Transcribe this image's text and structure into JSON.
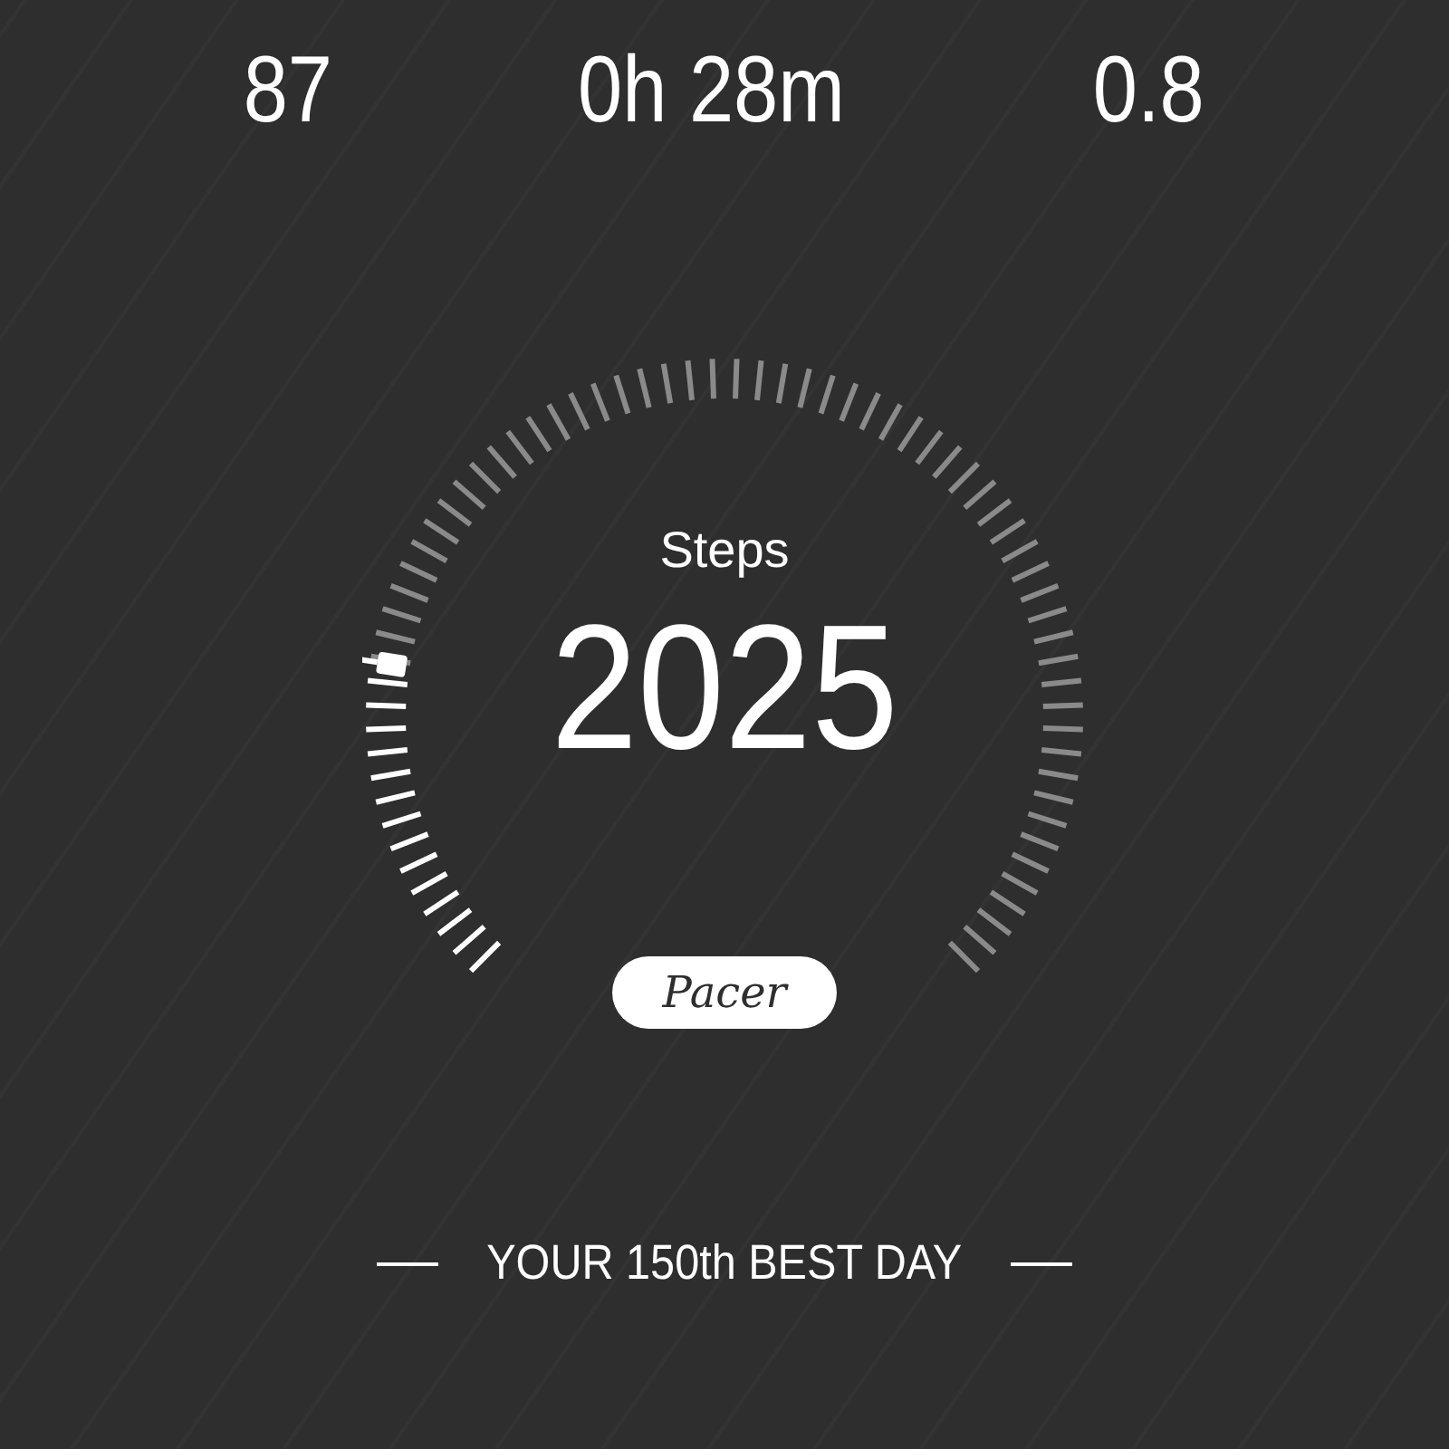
{
  "stats": [
    {
      "value": "87"
    },
    {
      "value": "0h 28m"
    },
    {
      "value": "0.8"
    }
  ],
  "gauge": {
    "label": "Steps",
    "value": "2025"
  },
  "badge": "Pacer",
  "rank": "YOUR 150th BEST DAY"
}
